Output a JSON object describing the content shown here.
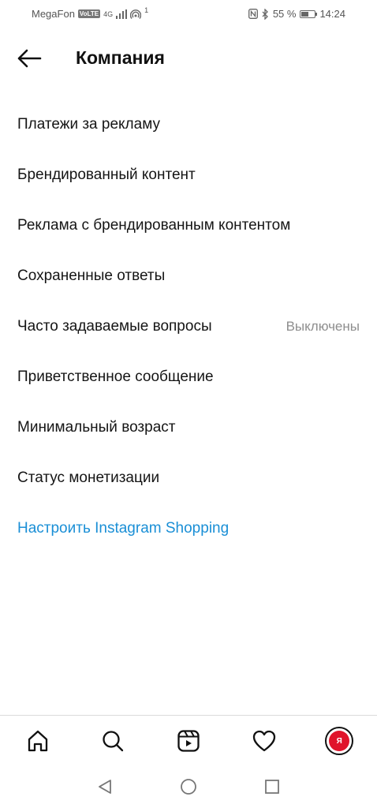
{
  "status": {
    "carrier": "MegaFon",
    "volte": "VoLTE",
    "network": "4G",
    "hotspot_count": "1",
    "battery_percent": "55 %",
    "time": "14:24",
    "battery_level": 0.55
  },
  "header": {
    "title": "Компания"
  },
  "menu": {
    "items": [
      {
        "label": "Платежи за рекламу"
      },
      {
        "label": "Брендированный контент"
      },
      {
        "label": "Реклама с брендированным контентом"
      },
      {
        "label": "Сохраненные ответы"
      },
      {
        "label": "Часто задаваемые вопросы",
        "value": "Выключены"
      },
      {
        "label": "Приветственное сообщение"
      },
      {
        "label": "Минимальный возраст"
      },
      {
        "label": "Статус монетизации"
      },
      {
        "label": "Настроить Instagram Shopping"
      }
    ]
  },
  "colors": {
    "link": "#1a8fd6",
    "text": "#151515",
    "muted": "#8e8e8e",
    "avatar": "#e0142b"
  },
  "bottom_nav": {
    "avatar_text": "Я"
  }
}
